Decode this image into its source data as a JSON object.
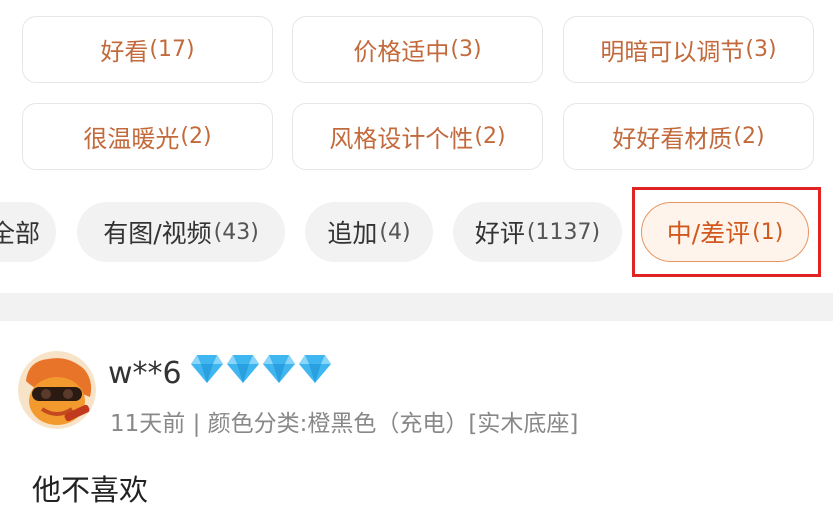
{
  "tags": [
    {
      "label": "好看",
      "count": "(17)"
    },
    {
      "label": "价格适中",
      "count": "(3)"
    },
    {
      "label": "明暗可以调节",
      "count": "(3)"
    },
    {
      "label": "很温暖光",
      "count": "(2)"
    },
    {
      "label": "风格设计个性",
      "count": "(2)"
    },
    {
      "label": "好好看材质",
      "count": "(2)"
    }
  ],
  "filters": [
    {
      "label": "全部",
      "count": ""
    },
    {
      "label": "有图/视频",
      "count": "(43)"
    },
    {
      "label": "追加",
      "count": "(4)"
    },
    {
      "label": "好评",
      "count": "(1137)"
    },
    {
      "label": "中/差评",
      "count": "(1)"
    }
  ],
  "active_filter": "中/差评",
  "colors": {
    "accent": "#d05a1e",
    "highlight_box": "#e02323",
    "diamond": "#3fb6f0"
  },
  "review": {
    "username": "w**6",
    "level_icon": "diamond-icon",
    "level_count": 4,
    "meta": "11天前 | 颜色分类:橙黑色（充电）[实木底座]",
    "content": "他不喜欢"
  }
}
